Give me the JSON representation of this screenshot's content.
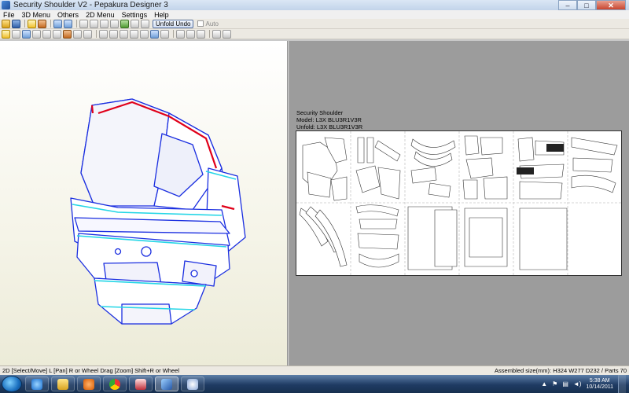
{
  "window": {
    "title": "Security Shoulder V2 - Pepakura Designer 3",
    "controls": {
      "minimize": "–",
      "maximize": "□",
      "close": "✕"
    }
  },
  "menu": [
    "File",
    "3D Menu",
    "Others",
    "2D Menu",
    "Settings",
    "Help"
  ],
  "toolbar": {
    "unfold_undo_label": "Unfold Undo",
    "auto_label": "Auto"
  },
  "sheet": {
    "title": "Security Shoulder",
    "model_line": "Model: L3X BLU3R1V3R",
    "unfold_line": "Unfold: L3X BLU3R1V3R"
  },
  "status": {
    "left": "2D [Select/Move] L [Pan] R or Wheel Drag [Zoom] Shift+R or Wheel",
    "right": "Assembled size(mm): H324 W277 D232 / Parts 70"
  },
  "taskbar": {
    "time": "5:38 AM",
    "date": "10/14/2011",
    "apps": [
      "internet-explorer",
      "file-explorer",
      "media-player",
      "chrome",
      "game-app",
      "pepakura-app",
      "paint-app"
    ]
  },
  "colors": {
    "outline_blue": "#1a2ee0",
    "edge_cyan": "#24d6e6",
    "cut_red": "#e0001a",
    "paper_bg": "#ffffff",
    "workspace_bg": "#9c9c9c"
  }
}
